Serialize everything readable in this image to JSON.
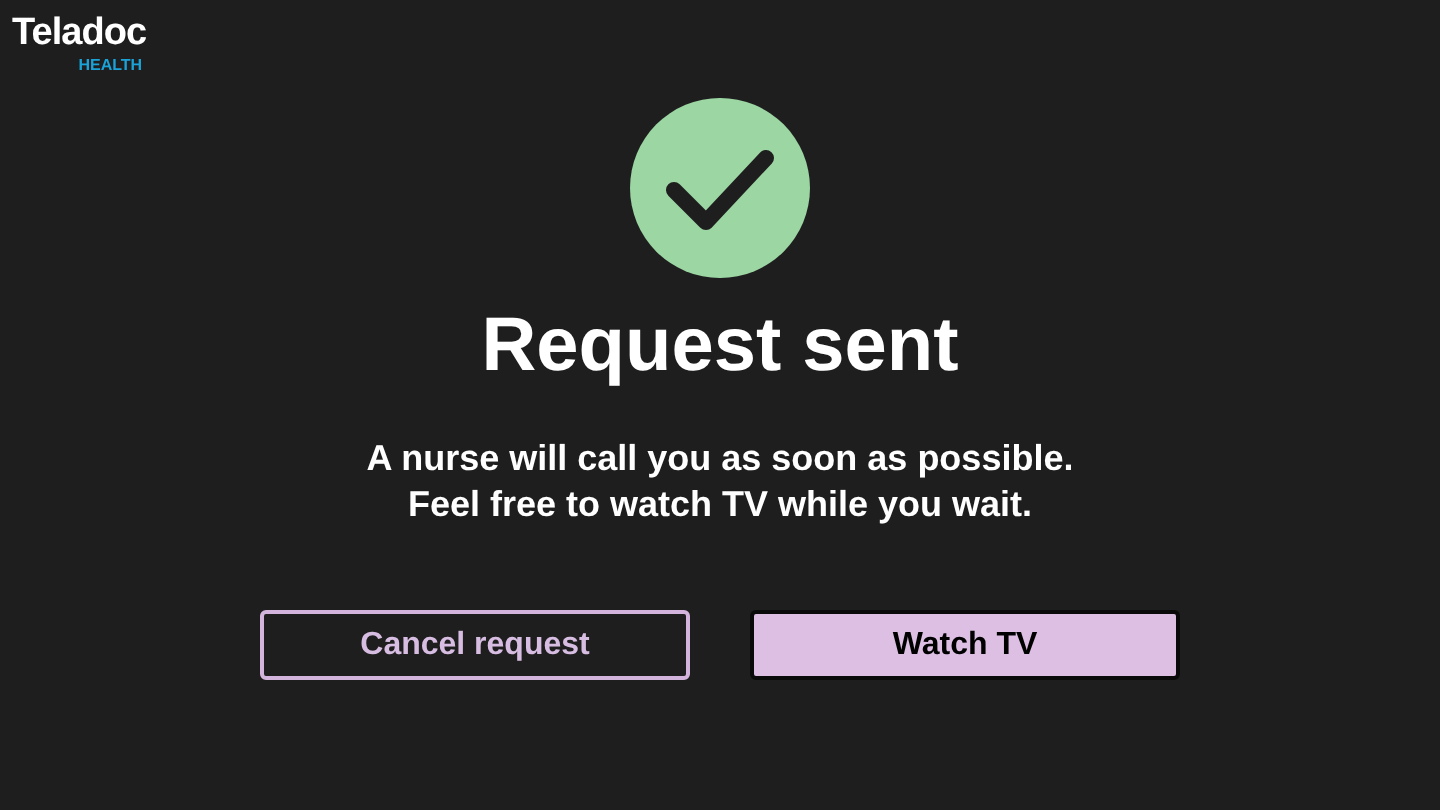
{
  "logo": {
    "name": "Teladoc",
    "subtitle": "HEALTH"
  },
  "title": "Request sent",
  "message": [
    "A nurse will call you as soon as possible.",
    "Feel free to watch TV while you wait."
  ],
  "buttons": [
    {
      "label": "Cancel request",
      "selected": false
    },
    {
      "label": "Watch TV",
      "selected": true
    }
  ]
}
